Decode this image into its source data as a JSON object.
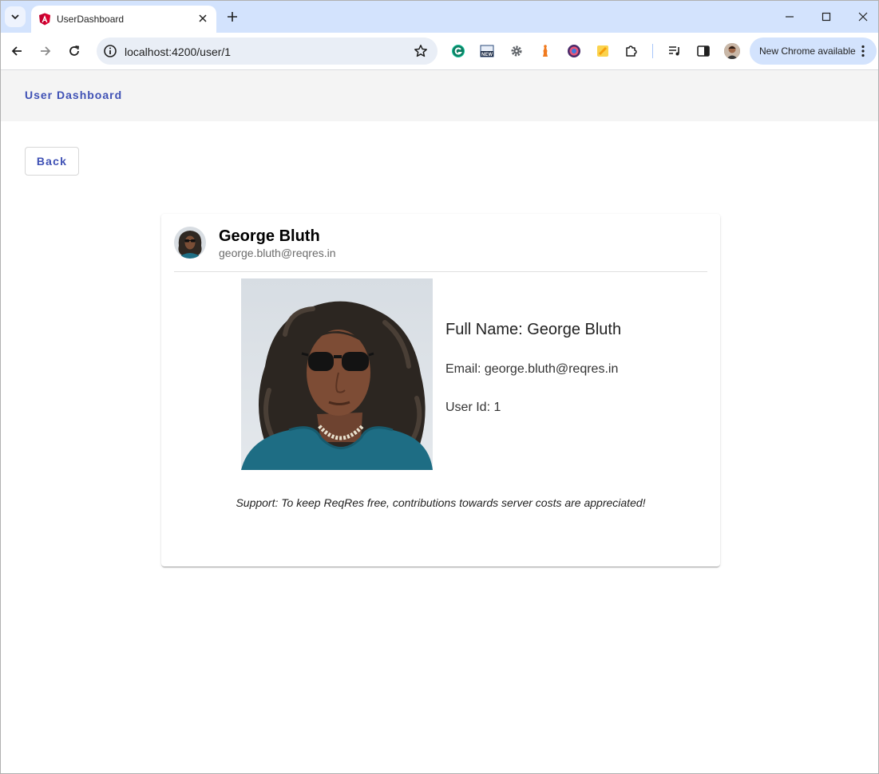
{
  "browser": {
    "tab_title": "UserDashboard",
    "url": "localhost:4200/user/1",
    "update_label": "New Chrome available",
    "accent_color": "#d3e3fd",
    "extensions": [
      "grammarly-icon",
      "new-badge-icon",
      "gear-extension-icon",
      "chess-extension-icon",
      "color-picker-icon",
      "notes-extension-icon",
      "puzzle-icon",
      "media-control-icon",
      "side-panel-icon"
    ]
  },
  "app": {
    "title": "User Dashboard",
    "back_label": "Back",
    "brand_color": "#3f51b5"
  },
  "user": {
    "name": "George Bluth",
    "email": "george.bluth@reqres.in",
    "full_name_line": "Full Name: George Bluth",
    "email_line": "Email: george.bluth@reqres.in",
    "id_line": "User Id: 1"
  },
  "support_text": "Support: To keep ReqRes free, contributions towards server costs are appreciated!"
}
